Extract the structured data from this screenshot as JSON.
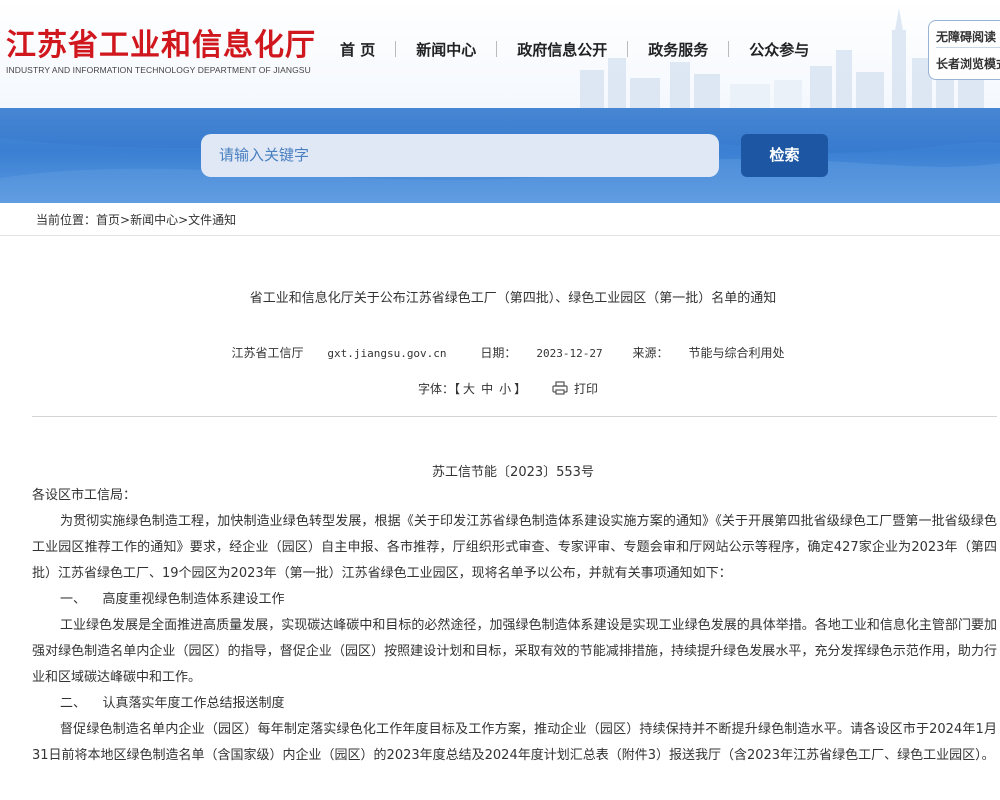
{
  "header": {
    "logo_cn": "江苏省工业和信息化厅",
    "logo_en": "INDUSTRY AND INFORMATION TECHNOLOGY DEPARTMENT OF JIANGSU",
    "nav": [
      "首 页",
      "新闻中心",
      "政府信息公开",
      "政务服务",
      "公众参与"
    ],
    "accessibility": "无障碍阅读",
    "elder_mode": "长者浏览模式"
  },
  "search": {
    "placeholder": "请输入关键字",
    "button": "检索"
  },
  "breadcrumb": {
    "label": "当前位置：",
    "items": [
      "首页",
      "新闻中心",
      "文件通知"
    ]
  },
  "article": {
    "title": "省工业和信息化厅关于公布江苏省绿色工厂（第四批）、绿色工业园区（第一批）名单的通知",
    "publisher": "江苏省工信厅",
    "site": "gxt.jiangsu.gov.cn",
    "date_label": "日期：",
    "date": "2023-12-27",
    "source_label": "来源：",
    "source": "节能与综合利用处",
    "font_label": "字体：【",
    "font_sizes": [
      "大",
      "中",
      "小"
    ],
    "font_close": "】",
    "print": "打印",
    "doc_no": "苏工信节能〔2023〕553号",
    "salutation": "各设区市工信局：",
    "para1": "为贯彻实施绿色制造工程，加快制造业绿色转型发展，根据《关于印发江苏省绿色制造体系建设实施方案的通知》《关于开展第四批省级绿色工厂暨第一批省级绿色工业园区推荐工作的通知》要求，经企业（园区）自主申报、各市推荐，厅组织形式审查、专家评审、专题会审和厅网站公示等程序，确定427家企业为2023年（第四批）江苏省绿色工厂、19个园区为2023年（第一批）江苏省绿色工业园区，现将名单予以公布，并就有关事项通知如下：",
    "sec1": "一、    高度重视绿色制造体系建设工作",
    "para2": "工业绿色发展是全面推进高质量发展，实现碳达峰碳中和目标的必然途径，加强绿色制造体系建设是实现工业绿色发展的具体举措。各地工业和信息化主管部门要加强对绿色制造名单内企业（园区）的指导，督促企业（园区）按照建设计划和目标，采取有效的节能减排措施，持续提升绿色发展水平，充分发挥绿色示范作用，助力行业和区域碳达峰碳中和工作。",
    "sec2": "二、    认真落实年度工作总结报送制度",
    "para3": "督促绿色制造名单内企业（园区）每年制定落实绿色化工作年度目标及工作方案，推动企业（园区）持续保持并不断提升绿色制造水平。请各设区市于2024年1月31日前将本地区绿色制造名单（含国家级）内企业（园区）的2023年度总结及2024年度计划汇总表（附件3）报送我厅（含2023年江苏省绿色工厂、绿色工业园区）。"
  },
  "colors": {
    "brand_red": "#d0171d",
    "band_blue": "#3a7fd3",
    "button_blue": "#1d57a3",
    "input_bg": "#dfe8f4"
  }
}
